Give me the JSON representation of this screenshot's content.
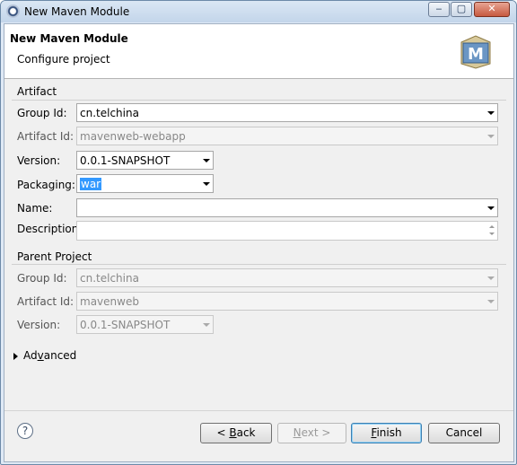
{
  "window": {
    "title": "New Maven Module",
    "controls": {
      "minimize": "‒",
      "maximize": "▢",
      "close": "✕"
    }
  },
  "banner": {
    "title": "New Maven Module",
    "subtitle": "Configure project",
    "logo_letter": "M"
  },
  "artifact": {
    "section_label": "Artifact",
    "group_id": {
      "label": "Group Id:",
      "value": "cn.telchina"
    },
    "artifact_id": {
      "label": "Artifact Id:",
      "value": "mavenweb-webapp"
    },
    "version": {
      "label": "Version:",
      "value": "0.0.1-SNAPSHOT"
    },
    "packaging": {
      "label": "Packaging:",
      "value": "war"
    },
    "name": {
      "label": "Name:",
      "value": ""
    },
    "description": {
      "label": "Description:",
      "value": ""
    }
  },
  "parent": {
    "section_label": "Parent Project",
    "group_id": {
      "label": "Group Id:",
      "value": "cn.telchina"
    },
    "artifact_id": {
      "label": "Artifact Id:",
      "value": "mavenweb"
    },
    "version": {
      "label": "Version:",
      "value": "0.0.1-SNAPSHOT"
    }
  },
  "advanced": {
    "label": "Advanced",
    "mnemonic": "v"
  },
  "footer": {
    "help": "?",
    "back": {
      "prefix": "< ",
      "mnemonic": "B",
      "rest": "ack"
    },
    "next": {
      "mnemonic": "N",
      "rest": "ext >"
    },
    "finish": {
      "mnemonic": "F",
      "rest": "inish"
    },
    "cancel": "Cancel"
  },
  "colors": {
    "selection": "#3399ff",
    "brand_logo": "#5a86b5"
  }
}
